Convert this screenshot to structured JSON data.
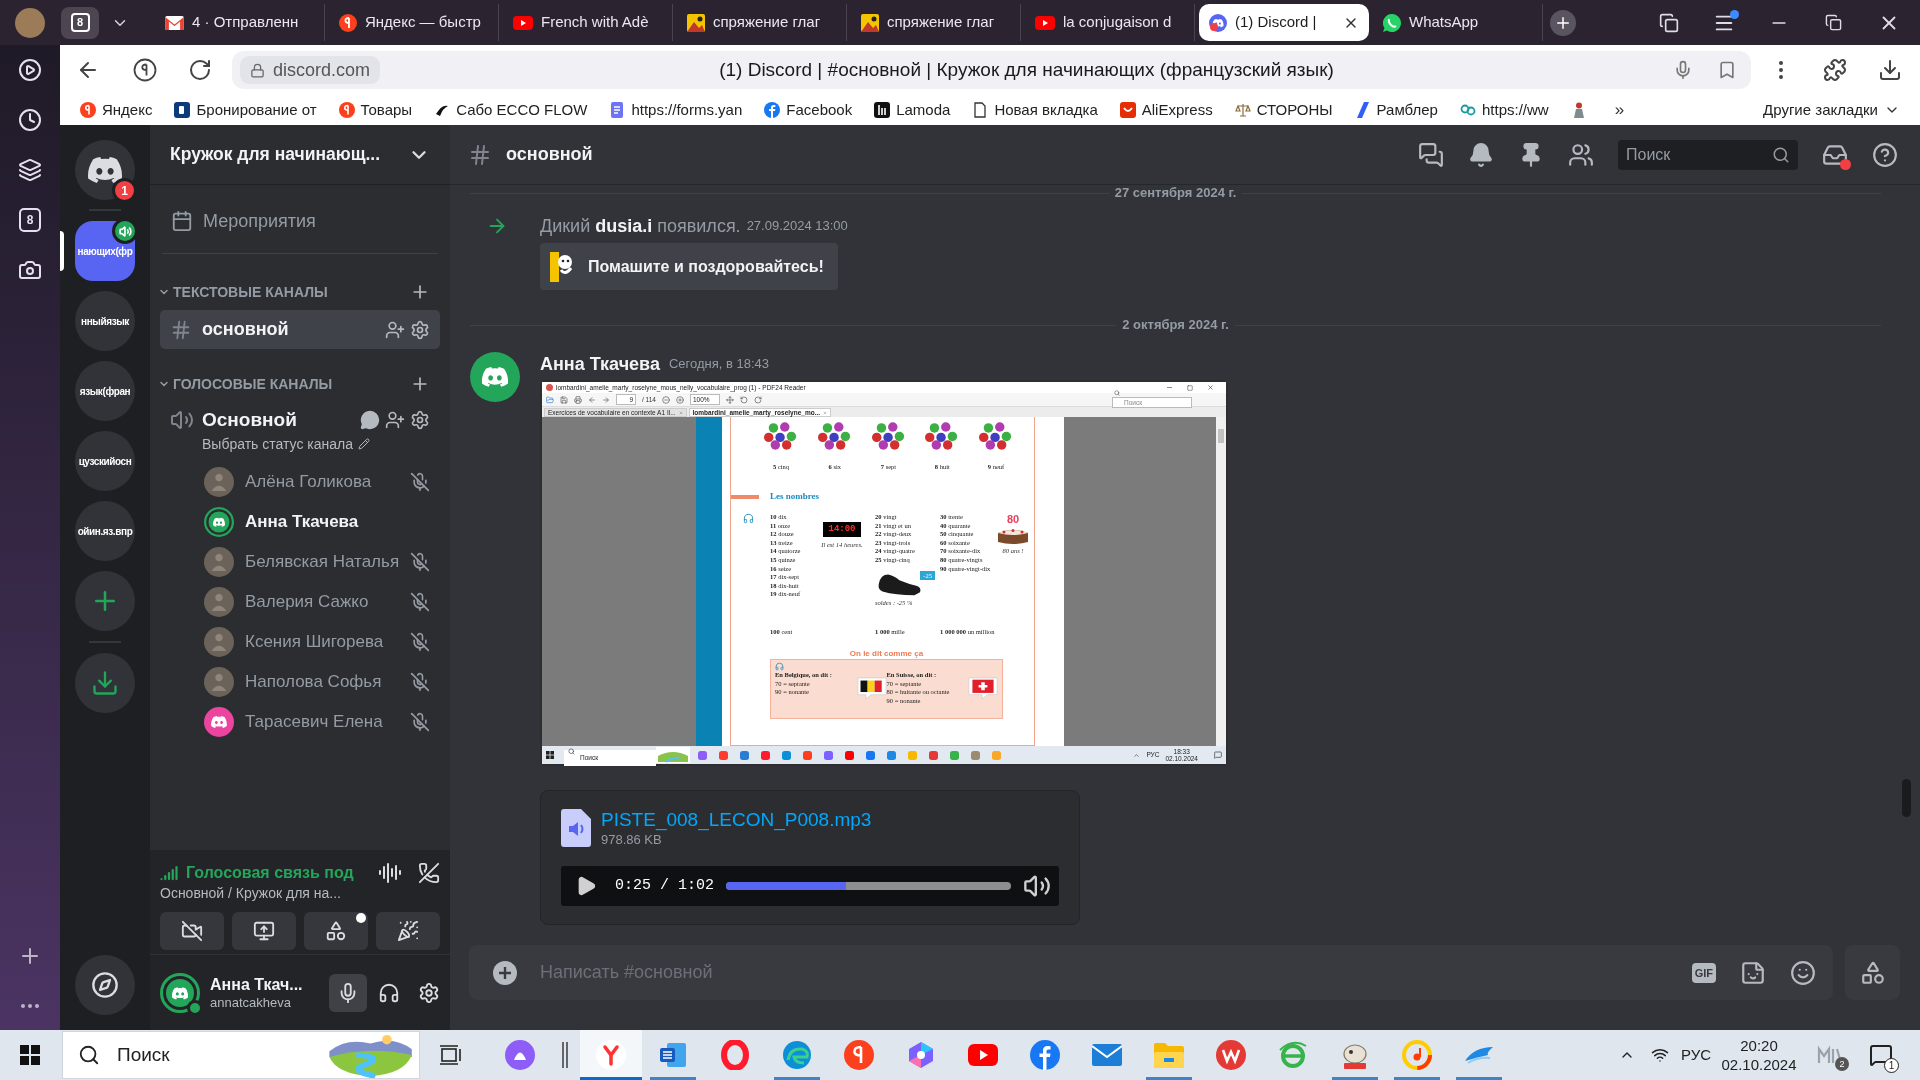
{
  "browser": {
    "tab_count": "8",
    "tabs": [
      {
        "kind": "mail",
        "label": "4 · Отправленн",
        "selected": false
      },
      {
        "kind": "search",
        "label": "Яндекс — быстр",
        "selected": false
      },
      {
        "kind": "video",
        "label": "French with Adè",
        "selected": false
      },
      {
        "kind": "image",
        "label": "спряжение глаг",
        "selected": false
      },
      {
        "kind": "image",
        "label": "спряжение глаг",
        "selected": false
      },
      {
        "kind": "video",
        "label": "la conjugaison d",
        "selected": false
      },
      {
        "kind": "discord",
        "label": "(1) Discord |",
        "selected": true
      },
      {
        "kind": "chat",
        "label": "WhatsApp",
        "selected": false
      }
    ],
    "menu_dot": true,
    "address": "discord.com",
    "page_title": "(1) Discord | #основной | Кружок для начинающих (французский язык)",
    "bookmarks": [
      {
        "kind": "yandex",
        "label": "Яндекс"
      },
      {
        "kind": "booking",
        "label": "Бронирование от"
      },
      {
        "kind": "yandex",
        "label": "Товары"
      },
      {
        "kind": "ecco",
        "label": "Сабо ECCO FLOW"
      },
      {
        "kind": "form",
        "label": "https://forms.yan"
      },
      {
        "kind": "facebook",
        "label": "Facebook"
      },
      {
        "kind": "lamoda",
        "label": "Lamoda"
      },
      {
        "kind": "page",
        "label": "Новая вкладка"
      },
      {
        "kind": "ali",
        "label": "AliExpress"
      },
      {
        "kind": "scales",
        "label": "СТОРОНЫ"
      },
      {
        "kind": "rambler",
        "label": "Рамблер"
      },
      {
        "kind": "pq",
        "label": "https://ww"
      },
      {
        "kind": "figure"
      }
    ],
    "overflow": "»",
    "other_bookmarks": "Другие закладки",
    "side_counter": "8"
  },
  "discord": {
    "home_badge": "1",
    "servers": [
      {
        "label": "нающих(фр",
        "selected": true,
        "in_voice": true
      },
      {
        "label": "нныйязык",
        "selected": false,
        "in_voice": false
      },
      {
        "label": "язык(фран",
        "selected": false,
        "in_voice": false
      },
      {
        "label": "цузскийосн",
        "selected": false,
        "in_voice": false
      },
      {
        "label": "ойин.яз.впр",
        "selected": false,
        "in_voice": false
      }
    ],
    "sidebar": {
      "server_name": "Кружок для начинающ...",
      "events": "Мероприятия",
      "text_category": {
        "label": "ТЕКСТОВЫЕ КАНАЛЫ",
        "channels": [
          {
            "name": "основной",
            "selected": true
          }
        ]
      },
      "voice_category": {
        "label": "ГОЛОСОВЫЕ КАНАЛЫ",
        "channels": [
          {
            "name": "Основной",
            "status": "Выбрать статус канала",
            "members": [
              {
                "name": "Алёна Голикова",
                "kind": "photo",
                "speaking": false,
                "muted": true
              },
              {
                "name": "Анна Ткачева",
                "kind": "default",
                "color": "#23a55a",
                "speaking": true,
                "muted": false
              },
              {
                "name": "Белявская Наталья",
                "kind": "photo",
                "speaking": false,
                "muted": true
              },
              {
                "name": "Валерия Сажко",
                "kind": "photo",
                "speaking": false,
                "muted": true
              },
              {
                "name": "Ксения Шигорева",
                "kind": "photo",
                "speaking": false,
                "muted": true
              },
              {
                "name": "Наполова Софья",
                "kind": "photo",
                "speaking": false,
                "muted": true
              },
              {
                "name": "Тарасевич Елена",
                "kind": "default",
                "color": "#eb459f",
                "speaking": false,
                "muted": true
              }
            ]
          }
        ]
      },
      "voice_panel": {
        "status": "Голосовая связь под",
        "location": "Основной / Кружок для на...",
        "activity_dot": true
      },
      "user": {
        "name": "Анна Ткач...",
        "handle": "annatcakheva",
        "online": true
      }
    },
    "channel": {
      "name": "основной",
      "search_placeholder": "Поиск",
      "inbox_dot": true
    },
    "messages": [
      {
        "kind": "divider",
        "label": "27 сентября 2024 г."
      },
      {
        "kind": "join",
        "text": "Дикий **dusia.i** появился.",
        "time": "27.09.2024 13:00",
        "button": "Помашите и поздоровайтесь!"
      },
      {
        "kind": "divider",
        "label": "2 октября 2024 г."
      },
      {
        "kind": "post",
        "author": "Анна Ткачева",
        "time": "Сегодня, в 18:43",
        "image": {
          "window_title": "lombardini_amelie_marty_roselyne_mous_nelly_vocabulaire_prog (1) - PDF24 Reader",
          "page": "9",
          "page_total": "/ 114",
          "zoom": "100%",
          "search_placeholder": "Поиск",
          "doc_tabs": [
            {
              "label": "Exercices de vocabulaire en contexte A1 Il...",
              "selected": false
            },
            {
              "label": "lombardini_amelie_marty_roselyne_mo...",
              "selected": true
            }
          ],
          "counts": [
            "**5** cinq",
            "**6** six",
            "**7** sept",
            "**8** huit",
            "**9** neuf"
          ],
          "heading": "Les nombres",
          "column_1": [
            "**10** dix",
            "**11** onze",
            "**12** douze",
            "**13** treize",
            "**14** quatorze",
            "**15** quinze",
            "**16** seize",
            "**17** dix-sept",
            "**18** dix-huit",
            "**19** dix-neuf"
          ],
          "clock": "14:00",
          "clock_caption": "Il est 14 heures.",
          "column_2": [
            "**20** vingt",
            "**21** vingt et un",
            "**22** vingt-deux",
            "**23** vingt-trois",
            "**24** vingt-quatre",
            "**25** vingt-cinq"
          ],
          "tag": "-25",
          "tag_caption": "soldes : -25 %",
          "column_3": [
            "**30** trente",
            "**40** quarante",
            "**50** cinquante",
            "**60** soixante",
            "**70** soixante-dix",
            "**80** quatre-vingts",
            "**90** quatre-vingt-dix"
          ],
          "cake": "80",
          "cake_caption": "80 ans !",
          "big_numbers": [
            "**100** cent",
            "**1 000** mille",
            "**1 000 000** un million"
          ],
          "box_title": "On le dit comme ça",
          "box_columns": [
            {
              "heading": "En Belgique, on dit :",
              "lines": [
                "70 = septante",
                "90 = nonante"
              ],
              "kind": "belgium"
            },
            {
              "heading": "En Suisse, on dit :",
              "lines": [
                "70 = septante",
                "80 = huitante ou octante",
                "90 = nonante"
              ],
              "kind": "switzerland"
            }
          ],
          "taskbar": {
            "search_placeholder": "Поиск",
            "language": "РУС",
            "time": "18:33",
            "date": "02.10.2024"
          }
        },
        "file": {
          "name": "PISTE_008_LECON_P008.mp3",
          "size": "978.86 KB",
          "time": "0:25 / 1:02",
          "level": 0.42
        }
      }
    ],
    "composer": {
      "placeholder": "Написать #основной",
      "gif": "GIF"
    }
  },
  "taskbar": {
    "search_placeholder": "Поиск",
    "apps": [
      {
        "kind": "browser",
        "running": true,
        "selected": true
      },
      {
        "kind": "word",
        "running": true,
        "selected": false
      },
      {
        "kind": "opera",
        "running": false,
        "selected": false
      },
      {
        "kind": "edge",
        "running": true,
        "selected": false
      },
      {
        "kind": "yandex",
        "running": false,
        "selected": false
      },
      {
        "kind": "copilot",
        "running": false,
        "selected": false
      },
      {
        "kind": "youtube",
        "running": false,
        "selected": false
      },
      {
        "kind": "facebook",
        "running": false,
        "selected": false
      },
      {
        "kind": "mail",
        "running": false,
        "selected": false
      },
      {
        "kind": "explorer",
        "running": true,
        "selected": false
      },
      {
        "kind": "wps",
        "running": false,
        "selected": false
      },
      {
        "kind": "ie",
        "running": false,
        "selected": false
      },
      {
        "kind": "pdf",
        "running": true,
        "selected": false
      },
      {
        "kind": "music",
        "running": true,
        "selected": false
      },
      {
        "kind": "cloud",
        "running": true,
        "selected": false
      }
    ],
    "language": "РУС",
    "time": "20:20",
    "date": "02.10.2024",
    "widget_badge": "2",
    "notifications": "1"
  }
}
